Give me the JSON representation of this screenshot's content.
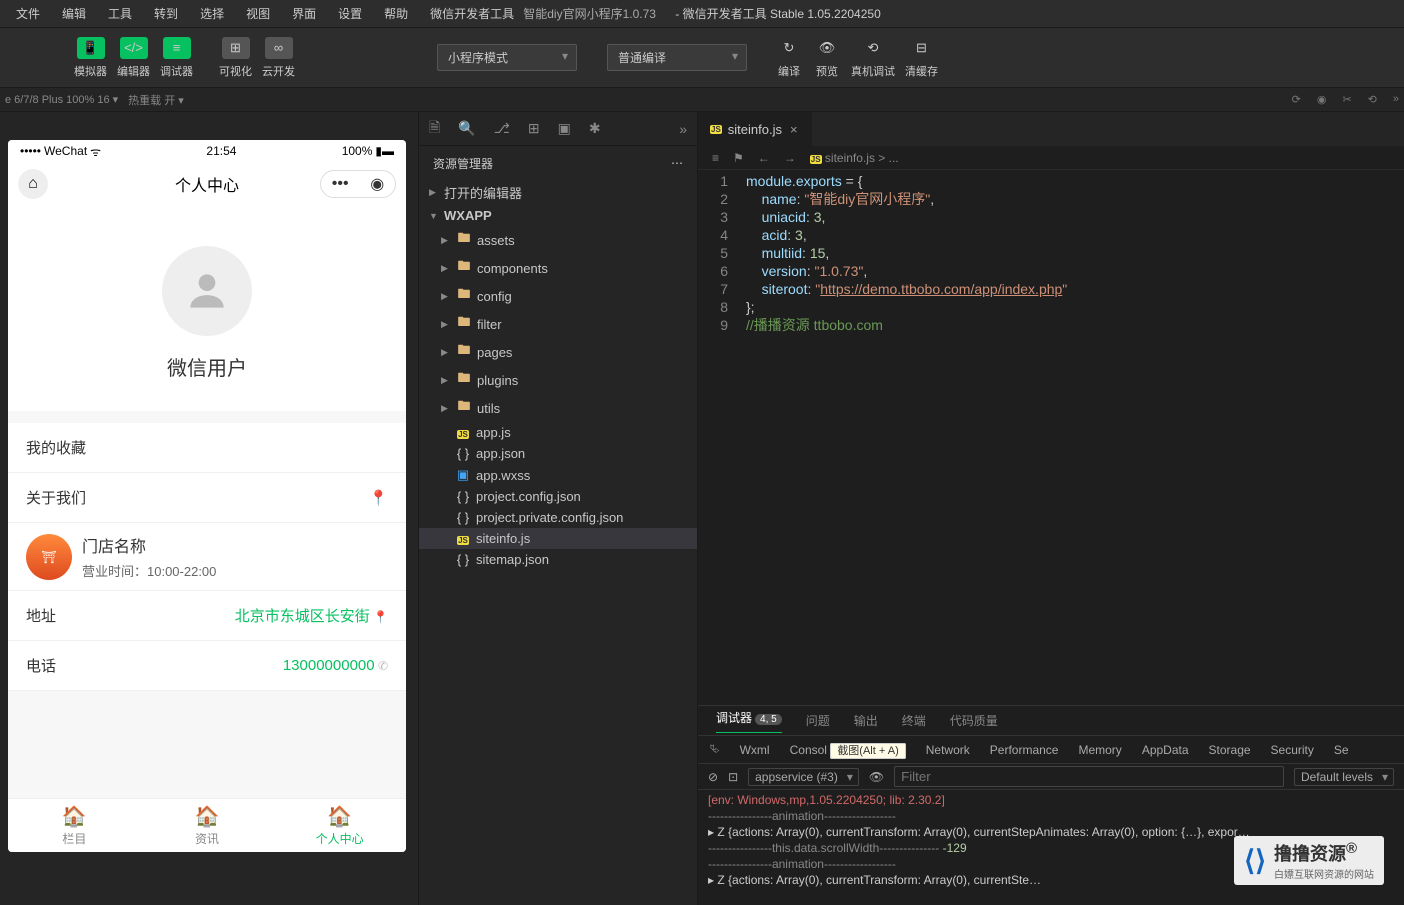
{
  "menubar": [
    "文件",
    "编辑",
    "工具",
    "转到",
    "选择",
    "视图",
    "界面",
    "设置",
    "帮助",
    "微信开发者工具"
  ],
  "title": {
    "main": "智能diy官网小程序1.0.73",
    "sub": " - 微信开发者工具 Stable 1.05.2204250"
  },
  "toolbar": {
    "simulator": "模拟器",
    "editor": "编辑器",
    "debugger": "调试器",
    "visualize": "可视化",
    "cloud": "云开发",
    "mode": "小程序模式",
    "compile_mode": "普通编译",
    "compile": "编译",
    "preview": "预览",
    "remote": "真机调试",
    "cache": "清缓存"
  },
  "sub_toolbar": {
    "device": "e 6/7/8 Plus 100% 16 ▾",
    "reload": "热重载 开 ▾"
  },
  "explorer": {
    "title": "资源管理器",
    "open_editors": "打开的编辑器",
    "root": "WXAPP",
    "folders": [
      "assets",
      "components",
      "config",
      "filter",
      "pages",
      "plugins",
      "utils"
    ],
    "files": [
      "app.js",
      "app.json",
      "app.wxss",
      "project.config.json",
      "project.private.config.json",
      "siteinfo.js",
      "sitemap.json"
    ],
    "selected": "siteinfo.js"
  },
  "editor": {
    "tab": "siteinfo.js",
    "breadcrumb": "siteinfo.js  >  ...",
    "code": {
      "l1": "module.exports = {",
      "l2": "    name: \"智能diy官网小程序\",",
      "l3": "    uniacid: 3,",
      "l4": "    acid: 3,",
      "l5": "    multiid: 15,",
      "l6": "    version: \"1.0.73\",",
      "l7_a": "    siteroot: \"",
      "l7_url": "https://demo.ttbobo.com/app/index.php",
      "l7_b": "\"",
      "l8": "};",
      "l9": "//播播资源 ttbobo.com"
    }
  },
  "phone": {
    "carrier": "WeChat",
    "time": "21:54",
    "battery": "100%",
    "nav_title": "个人中心",
    "username": "微信用户",
    "row1": "我的收藏",
    "row2": "关于我们",
    "store": "门店名称",
    "hours": "营业时间：10:00-22:00",
    "addr_lbl": "地址",
    "addr_val": "北京市东城区长安街",
    "tel_lbl": "电话",
    "tel_val": "13000000000",
    "tabs": [
      "栏目",
      "资讯",
      "个人中心"
    ]
  },
  "panel": {
    "tabs": [
      "调试器",
      "问题",
      "输出",
      "终端",
      "代码质量"
    ],
    "badge": "4, 5",
    "devtabs": [
      "Wxml",
      "Consol",
      "Network",
      "Performance",
      "Memory",
      "AppData",
      "Storage",
      "Security",
      "Se"
    ],
    "tooltip": "截图(Alt + A)",
    "context": "appservice (#3)",
    "filter": "Filter",
    "levels": "Default levels",
    "console": {
      "env": "[env: Windows,mp,1.05.2204250; lib: 2.30.2]",
      "anim": "----------------animation------------------",
      "z": "▸ Z {actions: Array(0), currentTransform: Array(0), currentStepAnimates: Array(0), option: {…}, expor…",
      "scroll_a": "----------------this.data.scrollWidth--------------- ",
      "scroll_b": "-129",
      "z2": "▸ Z {actions: Array(0), currentTransform: Array(0), currentSte…"
    }
  },
  "watermark": {
    "main": "撸撸资源",
    "sub": "白嫖互联网资源的网站",
    "r": "®"
  }
}
